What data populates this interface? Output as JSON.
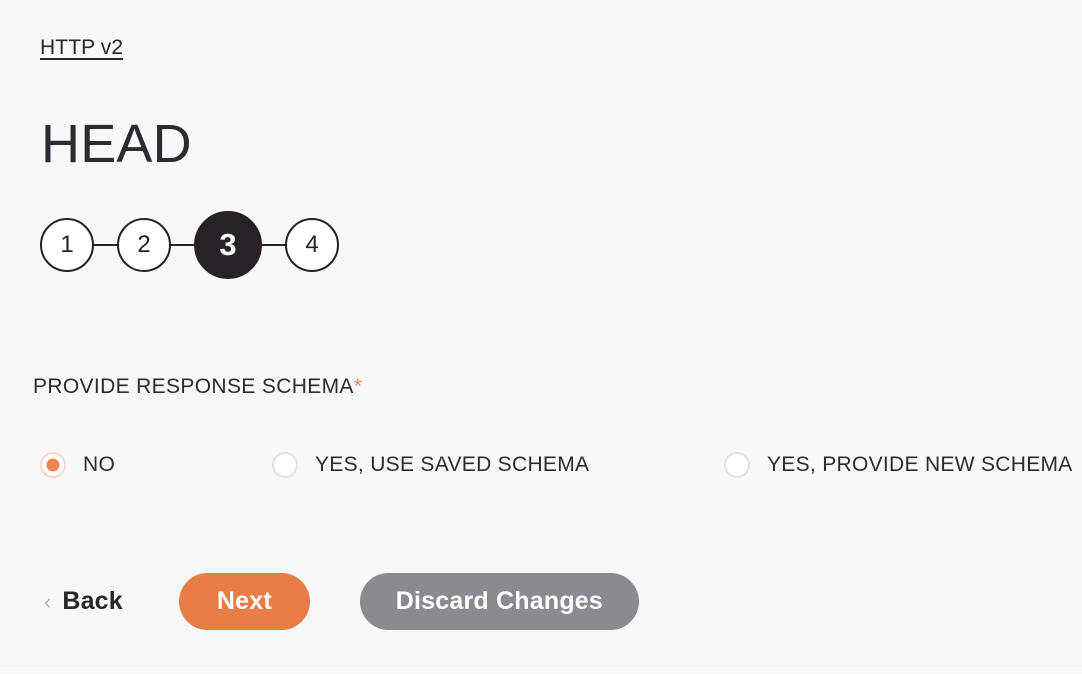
{
  "breadcrumb": {
    "label": "HTTP v2"
  },
  "header": {
    "title": "HEAD"
  },
  "stepper": {
    "current": 3,
    "steps": [
      {
        "label": "1",
        "active": false
      },
      {
        "label": "2",
        "active": false
      },
      {
        "label": "3",
        "active": true
      },
      {
        "label": "4",
        "active": false
      }
    ]
  },
  "form": {
    "field_label": "PROVIDE RESPONSE SCHEMA",
    "required_marker": "*",
    "options": [
      {
        "label": "NO",
        "checked": true
      },
      {
        "label": "YES, USE SAVED SCHEMA",
        "checked": false
      },
      {
        "label": "YES, PROVIDE NEW SCHEMA",
        "checked": false
      }
    ]
  },
  "actions": {
    "back_chevron": "‹",
    "back_label": "Back",
    "next_label": "Next",
    "discard_label": "Discard Changes"
  },
  "colors": {
    "background": "#f7f8fa",
    "accent_orange": "#ef8354",
    "next_button": "#e87d45",
    "discard_button": "#8a8a91",
    "dark": "#262227",
    "radio_border": "#e3e3e6"
  }
}
